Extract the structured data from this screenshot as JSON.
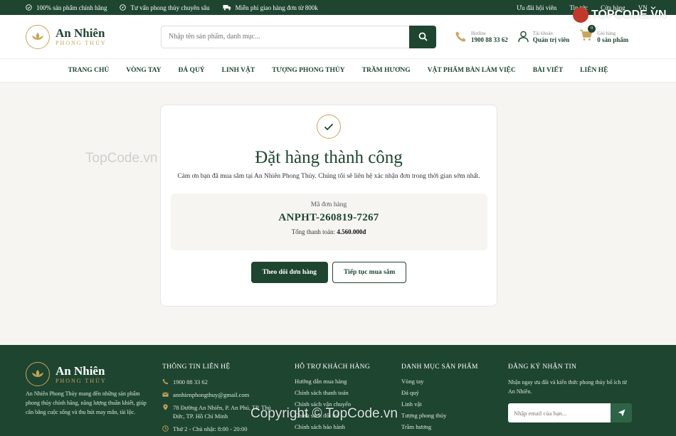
{
  "topbar": {
    "items": [
      "100% sản phẩm chính hãng",
      "Tư vấn phong thủy chuyên sâu",
      "Miễn phí giao hàng đơn từ 800k"
    ],
    "links": [
      "Ưu đãi hội viên",
      "Tin tức",
      "Cửa hàng"
    ],
    "lang": "VN"
  },
  "header": {
    "brand": "An Nhiên",
    "brand_sub": "PHONG THỦY",
    "search_placeholder": "Nhập tên sản phẩm, danh mục...",
    "hotline_label": "Hotline",
    "hotline": "1900 88 33 62",
    "account_label": "Tài khoản",
    "account": "Quản trị viên",
    "cart_label": "Giỏ hàng",
    "cart": "0 sản phẩm",
    "cart_count": "0"
  },
  "nav": [
    "TRANG CHỦ",
    "VÒNG TAY",
    "ĐÁ QUÝ",
    "LINH VẬT",
    "TƯỢNG PHONG THỦY",
    "TRẦM HƯƠNG",
    "VẬT PHẨM BÀN LÀM VIỆC",
    "BÀI VIẾT",
    "LIÊN HỆ"
  ],
  "success": {
    "title": "Đặt hàng thành công",
    "message": "Cảm ơn bạn đã mua sắm tại An Nhiên Phong Thủy. Chúng tôi sẽ liên hệ xác nhận đơn trong thời gian sớm nhất.",
    "order_label": "Mã đơn hàng",
    "order_code": "ANPHT-260819-7267",
    "total_label": "Tổng thanh toán:",
    "total_value": "4.560.000đ",
    "track_button": "Theo dõi đơn hàng",
    "continue_button": "Tiếp tục mua sắm"
  },
  "footer": {
    "about": "An Nhiên Phong Thủy mang đến những sản phẩm phong thủy chính hãng, năng lượng thuần khiết, giúp cân bằng cuộc sống và thu hút may mắn, tài lộc.",
    "contact_title": "THÔNG TIN LIÊN HỆ",
    "contact": [
      "1900 88 33 62",
      "annhienphongthuy@gmail.com",
      "78 Đường An Nhiên, P. An Phú, TP. Thủ Đức, TP. Hồ Chí Minh",
      "Thứ 2 - Chủ nhật: 8:00 - 20:00"
    ],
    "support_title": "HỖ TRỢ KHÁCH HÀNG",
    "support": [
      "Hướng dẫn mua hàng",
      "Chính sách thanh toán",
      "Chính sách vận chuyển",
      "Chính sách đổi trả",
      "Chính sách bảo hành"
    ],
    "category_title": "DANH MỤC SẢN PHẨM",
    "categories": [
      "Vòng tay",
      "Đá quý",
      "Linh vật",
      "Tượng phong thủy",
      "Trầm hương"
    ],
    "newsletter_title": "ĐĂNG KÝ NHẬN TIN",
    "newsletter_text": "Nhận ngay ưu đãi và kiến thức phong thủy bổ ích từ An Nhiên.",
    "newsletter_placeholder": "Nhập email của bạn..."
  },
  "watermarks": {
    "logo": "TOPCODE.VN",
    "side": "TopCode.vn",
    "bottom": "Copyright © TopCode.vn"
  },
  "colors": {
    "primary": "#1e4530",
    "accent": "#c9a45a"
  }
}
